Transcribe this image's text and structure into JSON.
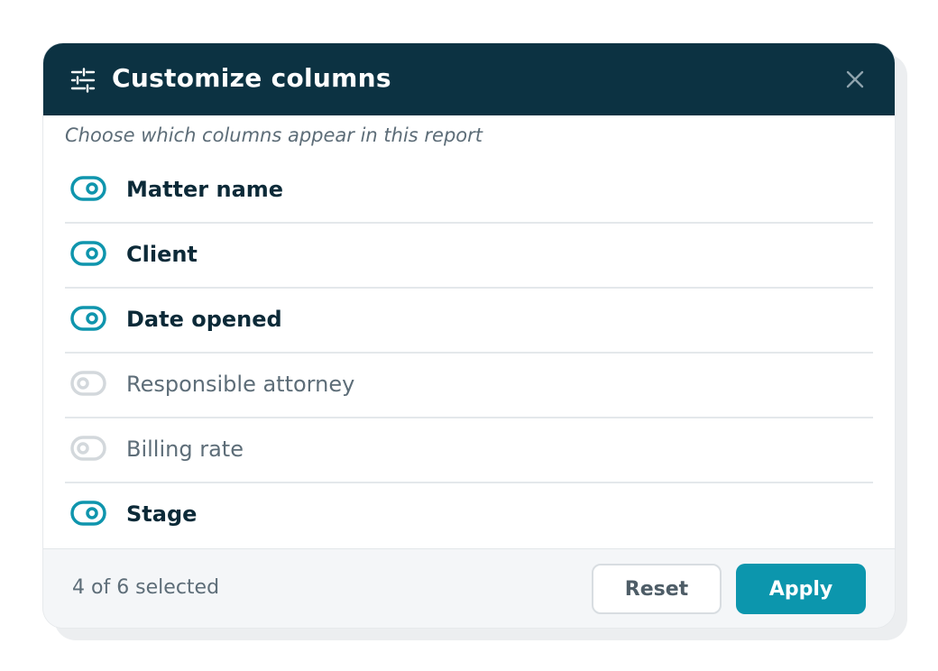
{
  "dialog": {
    "title": "Customize columns",
    "subtitle": "Choose which columns appear in this report",
    "header_icon": "sliders-icon",
    "close_icon": "close-icon"
  },
  "columns": [
    {
      "label": "Matter name",
      "enabled": true
    },
    {
      "label": "Client",
      "enabled": true
    },
    {
      "label": "Date opened",
      "enabled": true
    },
    {
      "label": "Responsible attorney",
      "enabled": false
    },
    {
      "label": "Billing rate",
      "enabled": false
    },
    {
      "label": "Stage",
      "enabled": true
    }
  ],
  "footer": {
    "selection_count": "4 of 6 selected",
    "reset_label": "Reset",
    "apply_label": "Apply"
  },
  "colors": {
    "header_bg": "#0c3242",
    "accent": "#0c96ad",
    "toggle_on": "#0f95ad",
    "toggle_off": "#d3d8dc"
  }
}
